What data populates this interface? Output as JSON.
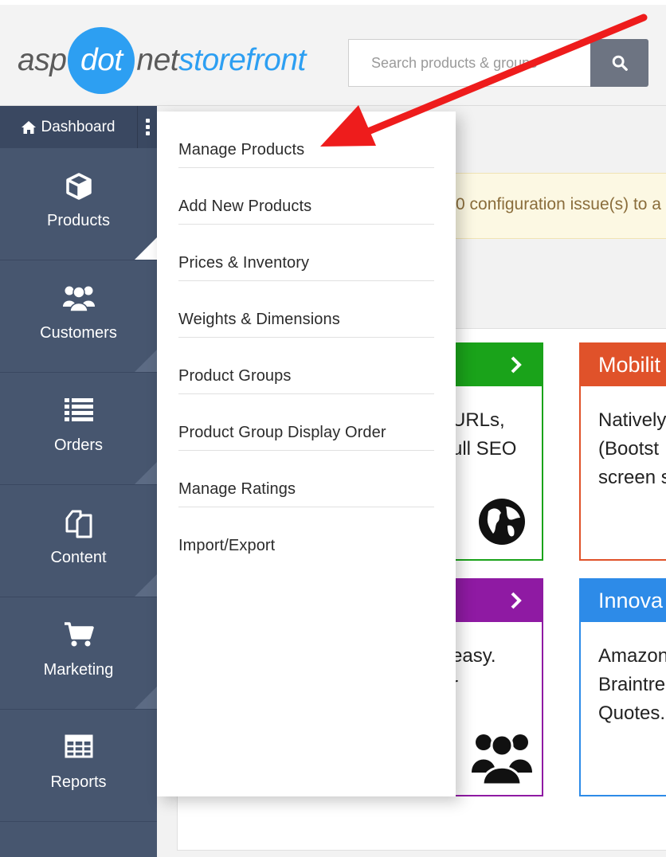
{
  "header": {
    "logo": {
      "asp": "asp",
      "dot": "dot",
      "net": "net",
      "storefront": "storefront"
    },
    "search": {
      "placeholder": "Search products & groups"
    },
    "colors": {
      "brand_blue": "#2d9ff2",
      "search_button": "#6d7482"
    }
  },
  "sidebar": {
    "dashboard_label": "Dashboard",
    "items": [
      {
        "label": "Products",
        "icon": "cube-icon"
      },
      {
        "label": "Customers",
        "icon": "users-icon"
      },
      {
        "label": "Orders",
        "icon": "list-icon"
      },
      {
        "label": "Content",
        "icon": "copy-icon"
      },
      {
        "label": "Marketing",
        "icon": "cart-icon"
      },
      {
        "label": "Reports",
        "icon": "table-icon"
      }
    ],
    "colors": {
      "background": "#47566f",
      "dashboard_bar": "#3a4861"
    }
  },
  "dropdown": {
    "items": [
      "Manage Products",
      "Add New Products",
      "Prices & Inventory",
      "Weights & Dimensions",
      "Product Groups",
      "Product Group Display Order",
      "Manage Ratings",
      "Import/Export"
    ]
  },
  "main": {
    "alert_text": "0 configuration issue(s) to a",
    "cards": [
      {
        "key": "seo",
        "title": "",
        "body": [
          "URLs,",
          "ull SEO"
        ],
        "icon": "globe-icon",
        "color": "#1aa31a"
      },
      {
        "key": "mobility",
        "title": "Mobilit",
        "body": [
          "Natively",
          "(Bootst",
          "screen s"
        ],
        "color": "#e0522a"
      },
      {
        "key": "customers",
        "title": "",
        "body": [
          "easy.",
          "r"
        ],
        "icon": "users-icon",
        "color": "#8f1aa3"
      },
      {
        "key": "innovation",
        "title": "Innova",
        "body": [
          "Amazon",
          "Braintre",
          "Quotes."
        ],
        "color": "#2d8be8"
      }
    ]
  },
  "annotation": {
    "arrow_color": "#ee1c1c"
  }
}
